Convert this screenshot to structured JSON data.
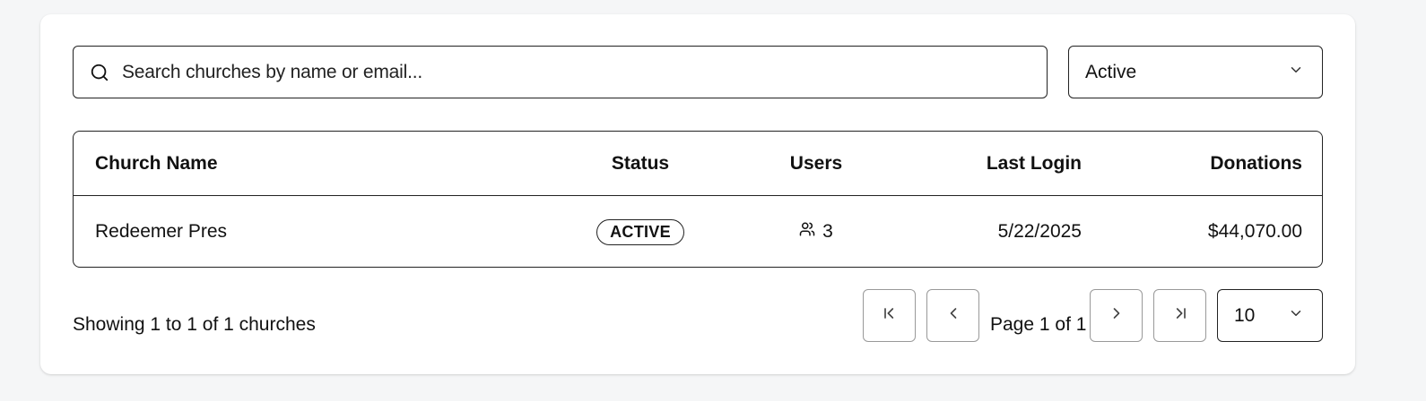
{
  "search": {
    "placeholder": "Search churches by name or email..."
  },
  "status_filter": {
    "selected": "Active"
  },
  "table": {
    "columns": [
      "Church Name",
      "Status",
      "Users",
      "Last Login",
      "Donations"
    ],
    "rows": [
      {
        "name": "Redeemer Pres",
        "status": "ACTIVE",
        "users": "3",
        "last_login": "5/22/2025",
        "donations": "$44,070.00"
      }
    ]
  },
  "pagination": {
    "summary": "Showing 1 to 1 of 1 churches",
    "page_label": "Page 1 of 1",
    "page_size": "10"
  },
  "icons": {
    "search": "search-icon",
    "dropdown": "chevron-down-icon",
    "users": "users-icon",
    "first": "chevrons-first-icon",
    "prev": "chevron-left-icon",
    "next": "chevron-right-icon",
    "last": "chevrons-last-icon"
  },
  "colors": {
    "border": "#222222",
    "muted_border": "#999999",
    "background": "#f5f6f7"
  }
}
